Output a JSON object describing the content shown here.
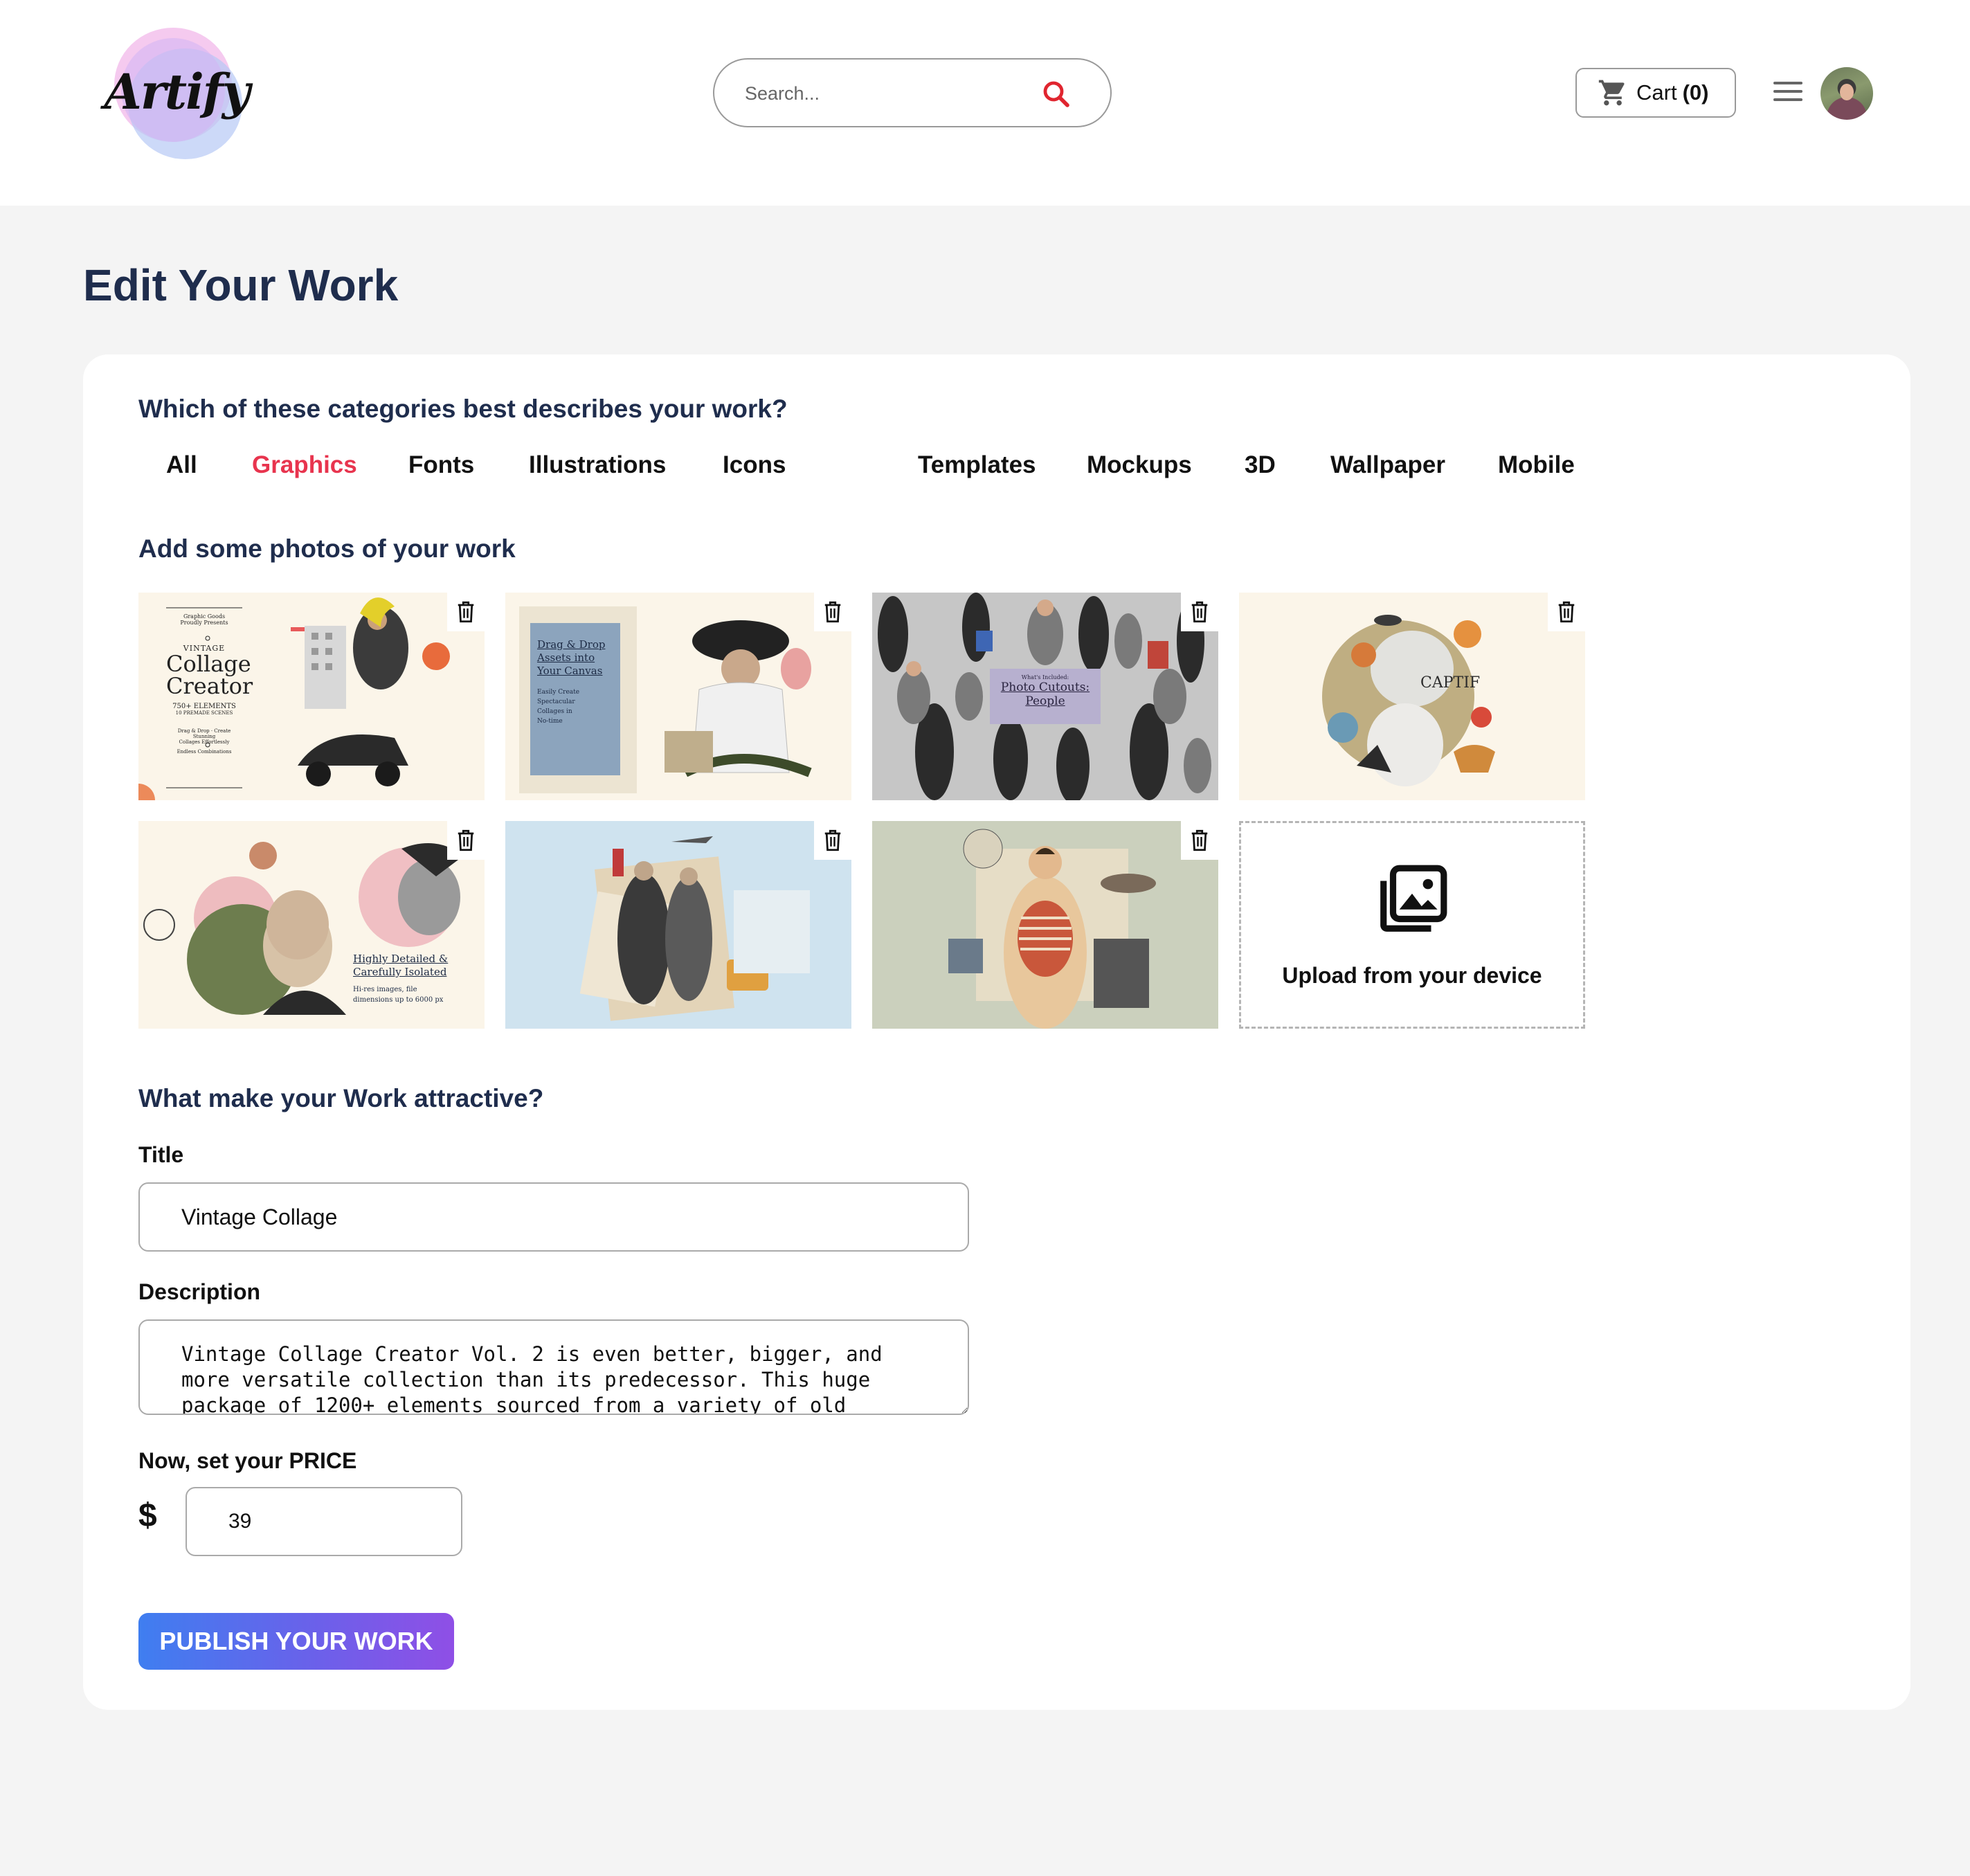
{
  "brand": {
    "logo_text": "Artify"
  },
  "header": {
    "search": {
      "placeholder": "Search..."
    },
    "cart": {
      "label": "Cart",
      "count": "(0)"
    }
  },
  "page": {
    "title": "Edit Your Work"
  },
  "categories": {
    "question": "Which of these categories best describes your work?",
    "items": [
      "All",
      "Graphics",
      "Fonts",
      "Illustrations",
      "Icons",
      "Templates",
      "Mockups",
      "3D",
      "Wallpaper",
      "Mobile"
    ],
    "selected": "Graphics",
    "active_color": "#e8344e"
  },
  "photos": {
    "heading": "Add some photos of your work",
    "images": [
      {
        "caption_lines": [
          "Graphic Goods",
          "Proudly Presents",
          "VINTAGE",
          "Collage",
          "Creator",
          "750+ ELEMENTS",
          "10 PREMADE SCENES",
          "Drag & Drop · Create Stunning",
          "Collages Effortlessly",
          "Endless Combinations"
        ]
      },
      {
        "caption_lines": [
          "Drag & Drop",
          "Assets into",
          "Your Canvas",
          "Easily Create",
          "Spectacular",
          "Collages in",
          "No-time"
        ]
      },
      {
        "caption_lines": [
          "What's Included:",
          "Photo Cutouts:",
          "People"
        ]
      },
      {
        "caption_lines": [
          "CAPTIF"
        ]
      },
      {
        "caption_lines": [
          "Highly Detailed &",
          "Carefully Isolated",
          "Hi-res images, file",
          "dimensions up to 6000 px"
        ]
      },
      {
        "caption_lines": []
      },
      {
        "caption_lines": []
      }
    ],
    "upload_label": "Upload from your device"
  },
  "details": {
    "heading": "What make your Work attractive?",
    "title_label": "Title",
    "title_value": "Vintage Collage",
    "description_label": "Description",
    "description_value": "Vintage Collage Creator Vol. 2 is even better, bigger, and more versatile collection than its predecessor. This huge package of 1200+ elements sourced from a variety of old",
    "price_label": "Now, set your PRICE",
    "currency": "$",
    "price_value": "39"
  },
  "actions": {
    "publish_label": "PUBLISH YOUR WORK"
  },
  "colors": {
    "heading": "#1f2d4d",
    "accent": "#e8344e",
    "button_gradient_start": "#3f7ef0",
    "button_gradient_end": "#8f4fe6"
  }
}
